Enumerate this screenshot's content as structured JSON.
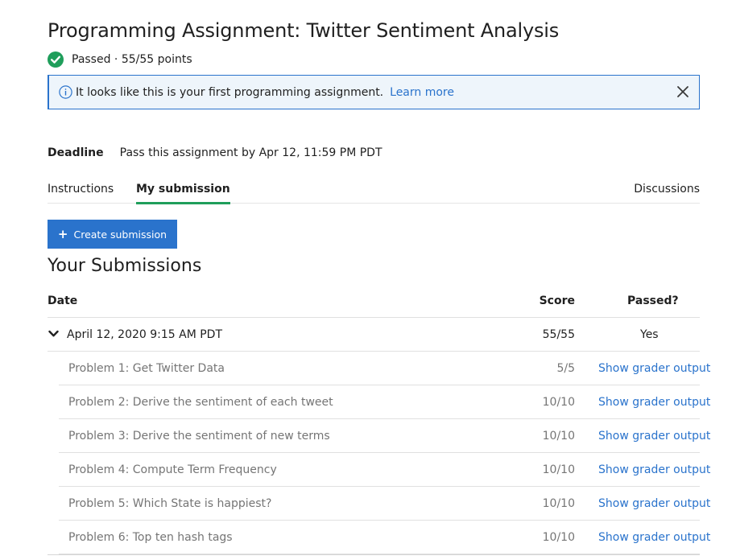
{
  "page": {
    "title": "Programming Assignment: Twitter Sentiment Analysis",
    "status": "Passed · 55/55 points"
  },
  "banner": {
    "text": "It looks like this is your first programming assignment.",
    "link": "Learn more"
  },
  "deadline": {
    "label": "Deadline",
    "text": "Pass this assignment by Apr 12, 11:59 PM PDT"
  },
  "tabs": [
    {
      "label": "Instructions",
      "active": false
    },
    {
      "label": "My submission",
      "active": true
    },
    {
      "label": "Discussions",
      "active": false
    }
  ],
  "create_button": "Create submission",
  "section_title": "Your Submissions",
  "table": {
    "headers": {
      "date": "Date",
      "score": "Score",
      "passed": "Passed?"
    },
    "submission": {
      "date": "April 12, 2020 9:15 AM PDT",
      "score": "55/55",
      "passed": "Yes"
    },
    "problems": [
      {
        "name": "Problem 1: Get Twitter Data",
        "score": "5/5",
        "link": "Show grader output"
      },
      {
        "name": "Problem 2: Derive the sentiment of each tweet",
        "score": "10/10",
        "link": "Show grader output"
      },
      {
        "name": "Problem 3: Derive the sentiment of new terms",
        "score": "10/10",
        "link": "Show grader output"
      },
      {
        "name": "Problem 4: Compute Term Frequency",
        "score": "10/10",
        "link": "Show grader output"
      },
      {
        "name": "Problem 5: Which State is happiest?",
        "score": "10/10",
        "link": "Show grader output"
      },
      {
        "name": "Problem 6: Top ten hash tags",
        "score": "10/10",
        "link": "Show grader output"
      }
    ]
  },
  "colors": {
    "accent": "#2a73cc",
    "success": "#1f9e5b",
    "banner_bg": "#eef5fb",
    "muted_text": "#757575"
  },
  "icons": [
    "check-circle-icon",
    "info-icon",
    "close-icon",
    "plus-icon",
    "chevron-down-icon"
  ]
}
